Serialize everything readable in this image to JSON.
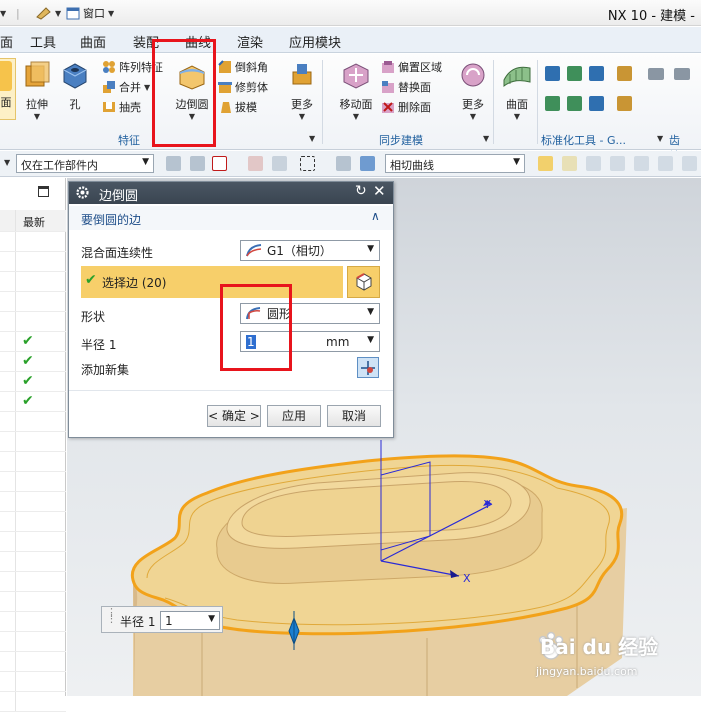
{
  "titlebar": {
    "window_menu": "窗口",
    "title": "NX 10 - 建模 -"
  },
  "menubar": {
    "items": [
      "面",
      "工具",
      "曲面",
      "装配",
      "曲线",
      "渲染",
      "应用模块"
    ]
  },
  "ribbon": {
    "big_buttons": [
      {
        "label": "面"
      },
      {
        "label": "拉伸"
      },
      {
        "label": "孔"
      },
      {
        "label": "边倒圆"
      },
      {
        "label": "更多"
      },
      {
        "label": "移动面"
      },
      {
        "label": "更多"
      },
      {
        "label": "曲面"
      }
    ],
    "feature_small": [
      "阵列特征",
      "合并",
      "抽壳"
    ],
    "blend_small": [
      "倒斜角",
      "修剪体",
      "拔模"
    ],
    "sync_small": [
      "偏置区域",
      "替换面",
      "删除面"
    ],
    "groups": {
      "feature": "特征",
      "sync": "同步建模",
      "std_tools": "标准化工具 - G...",
      "gear": "齿轮..."
    }
  },
  "toolbar2": {
    "scope_combo": "仅在工作部件内",
    "curve_combo": "相切曲线"
  },
  "navigator": {
    "header_latest": "最新",
    "check_count": 4
  },
  "dialog": {
    "title": "边倒圆",
    "section_title": "要倒圆的边",
    "continuity_label": "混合面连续性",
    "continuity_value": "G1（相切）",
    "select_edge": "选择边 (20)",
    "shape_label": "形状",
    "shape_value": "圆形",
    "radius_label": "半径 1",
    "radius_value": "1",
    "radius_unit": "mm",
    "add_set_label": "添加新集",
    "ok_button": "< 确定 >",
    "apply_button": "应用",
    "cancel_button": "取消"
  },
  "float_radius": {
    "label": "半径 1",
    "value": "1"
  },
  "watermark": {
    "logo": "Bai du 经验",
    "url": "jingyan.baidu.com"
  },
  "colors": {
    "annotation_red": "#e8141c",
    "selection_yellow": "#f7cf6a",
    "model_tan": "#f0d594",
    "model_side": "#e9cfa6",
    "edge_orange": "#f2a21a",
    "check_green": "#2aa12a"
  }
}
